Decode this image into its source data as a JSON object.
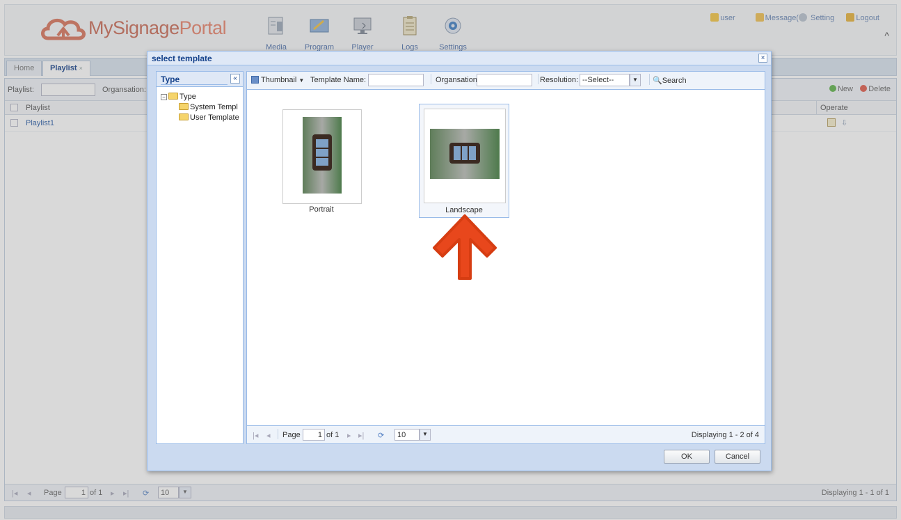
{
  "header": {
    "brand_part1": "MySignage",
    "brand_part2": "Portal",
    "nav": [
      {
        "label": "Media",
        "icon": "media-icon"
      },
      {
        "label": "Program",
        "icon": "program-icon"
      },
      {
        "label": "Player",
        "icon": "player-icon"
      },
      {
        "label": "Logs",
        "icon": "logs-icon"
      },
      {
        "label": "Settings",
        "icon": "settings-icon"
      }
    ],
    "user": "user",
    "message": "Message(",
    "setting": "Setting",
    "logout": "Logout",
    "collapse_glyph": "^"
  },
  "tabs": [
    {
      "label": "Home",
      "active": false
    },
    {
      "label": "Playlist",
      "active": true
    }
  ],
  "tab_close_glyph": "×",
  "background": {
    "toolbar": {
      "playlist_label": "Playlist:",
      "organisation_label": "Organsation:",
      "new_label": "New",
      "delete_label": "Delete"
    },
    "grid": {
      "col_playlist": "Playlist",
      "col_operate": "Operate",
      "rows": [
        "Playlist1"
      ]
    },
    "pager": {
      "page_label": "Page",
      "page_value": "1",
      "of_label": "of 1",
      "page_size": "10",
      "display": "Displaying 1 - 1 of 1"
    }
  },
  "dialog": {
    "title": "select template",
    "close_glyph": "×",
    "type_panel": {
      "title": "Type",
      "collapse_glyph": "«",
      "root": "Type",
      "expander_glyph": "−",
      "children": [
        "System Templ",
        "User Template"
      ]
    },
    "toolbar": {
      "view_label": "Thumbnail",
      "template_name_label": "Template Name:",
      "organisation_label": "Organsation:",
      "resolution_label": "Resolution:",
      "resolution_value": "--Select--",
      "search_label": "Search"
    },
    "templates": [
      {
        "name": "Portrait",
        "selected": false
      },
      {
        "name": "Landscape",
        "selected": true
      }
    ],
    "pager": {
      "page_label": "Page",
      "page_value": "1",
      "of_label": "of 1",
      "page_size": "10",
      "display": "Displaying 1 - 2 of 4"
    },
    "ok_label": "OK",
    "cancel_label": "Cancel"
  },
  "colors": {
    "accent": "#15428b",
    "arrow": "#e8471c",
    "brand": "#e8836b"
  }
}
